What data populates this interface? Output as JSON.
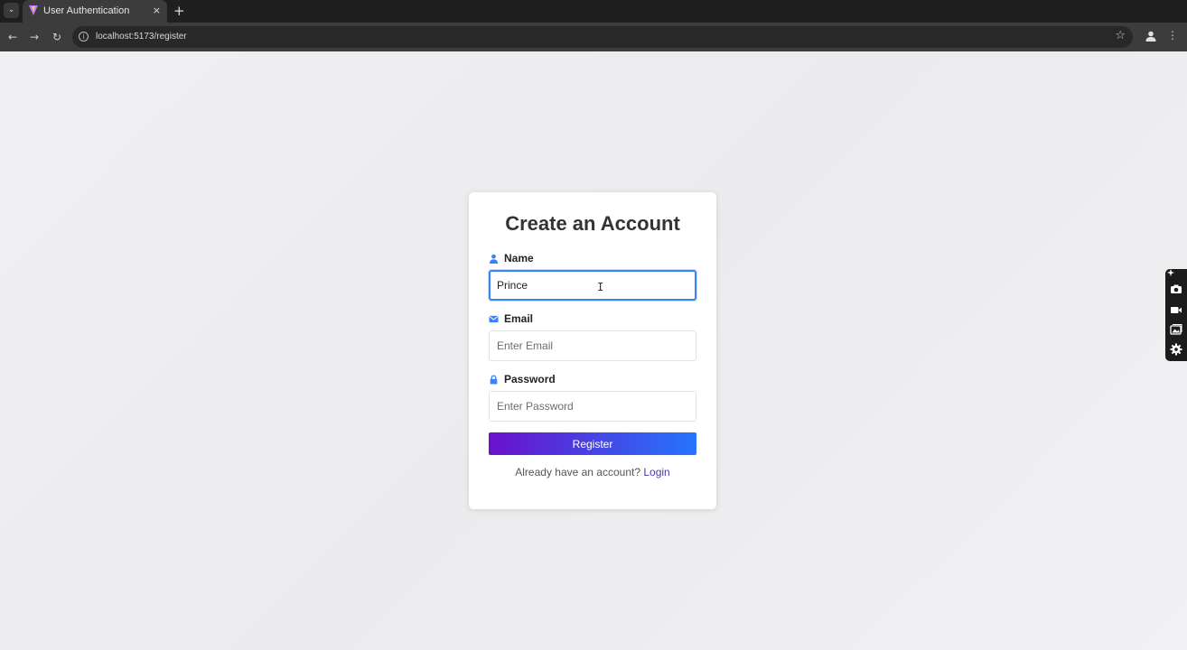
{
  "browser": {
    "tab_title": "User Authentication",
    "tab_close": "×",
    "new_tab": "+",
    "url": "localhost:5173/register"
  },
  "form": {
    "title": "Create an Account",
    "name_label": "Name",
    "name_value": "Prince",
    "email_label": "Email",
    "email_placeholder": "Enter Email",
    "password_label": "Password",
    "password_placeholder": "Enter Password",
    "register_label": "Register",
    "footer_text": "Already have an account?",
    "login_label": "Login"
  },
  "icons": {
    "name": "user-icon",
    "email": "envelope-icon",
    "password": "lock-icon",
    "widget": [
      "pin-icon",
      "camera-icon",
      "video-icon",
      "gallery-icon",
      "gear-icon"
    ]
  },
  "colors": {
    "accent": "#3b82f6",
    "gradient_start": "#6a11cb",
    "gradient_end": "#2575fc",
    "login_link": "#4a3aa8"
  }
}
